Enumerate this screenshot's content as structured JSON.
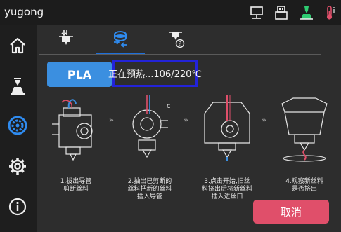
{
  "app": {
    "title": "yugong"
  },
  "topbar_icons": [
    "network-icon",
    "usb-icon",
    "printer-status-icon",
    "temperature-icon"
  ],
  "sidebar": {
    "items": [
      {
        "name": "home-icon"
      },
      {
        "name": "print-icon"
      },
      {
        "name": "filament-icon",
        "active": true
      },
      {
        "name": "settings-icon"
      },
      {
        "name": "info-icon"
      }
    ]
  },
  "tabs": [
    {
      "name": "load-filament-tab"
    },
    {
      "name": "change-filament-tab",
      "active": true
    },
    {
      "name": "filament-help-tab"
    }
  ],
  "material": {
    "label": "PLA"
  },
  "status": {
    "text": "正在预热...106/220℃"
  },
  "steps": [
    {
      "caption_line1": "1.拔出导管",
      "caption_line2": "剪断丝料"
    },
    {
      "caption_line1": "2.抽出已剪断的",
      "caption_line2": "丝料把新的丝料",
      "caption_line3": "插入导管"
    },
    {
      "caption_line1": "3.点击开始,旧丝",
      "caption_line2": "料挤出后将新丝料",
      "caption_line3": "插入进丝口"
    },
    {
      "caption_line1": "4.观察新丝料",
      "caption_line2": "是否挤出"
    }
  ],
  "actions": {
    "cancel_label": "取消"
  },
  "colors": {
    "accent": "#3b8fe0",
    "cancel": "#e04f6a",
    "active_icon": "#2f8bef",
    "status_border": "#2323d8"
  }
}
